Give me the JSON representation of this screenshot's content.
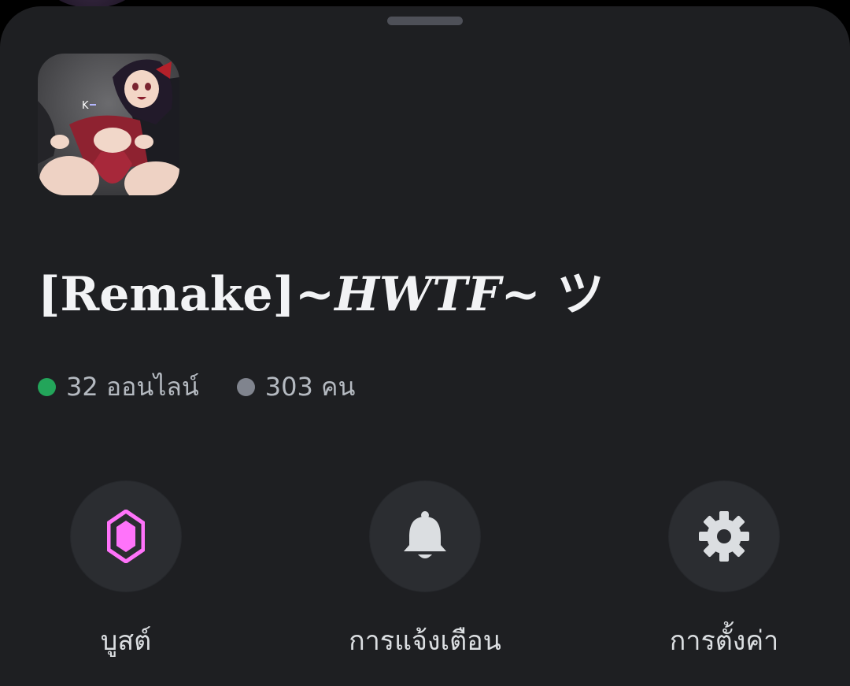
{
  "server": {
    "name_bracket": "[Remake]~",
    "name_italic": "HWTF~",
    "name_suffix": " ツ"
  },
  "stats": {
    "online_text": "32 ออนไลน์",
    "members_text": "303 คน",
    "online_color": "#23a55a",
    "members_color": "#80848e"
  },
  "actions": [
    {
      "label": "บูสต์",
      "icon": "boost-gem-icon",
      "color": "#ff73fa"
    },
    {
      "label": "การแจ้งเตือน",
      "icon": "bell-icon",
      "color": "#dbdee1"
    },
    {
      "label": "การตั้งค่า",
      "icon": "gear-icon",
      "color": "#dbdee1"
    }
  ],
  "colors": {
    "sheet_background": "#1e1f22",
    "button_background": "#2b2d31",
    "text_primary": "#f2f3f5",
    "text_secondary": "#b5bac1"
  }
}
